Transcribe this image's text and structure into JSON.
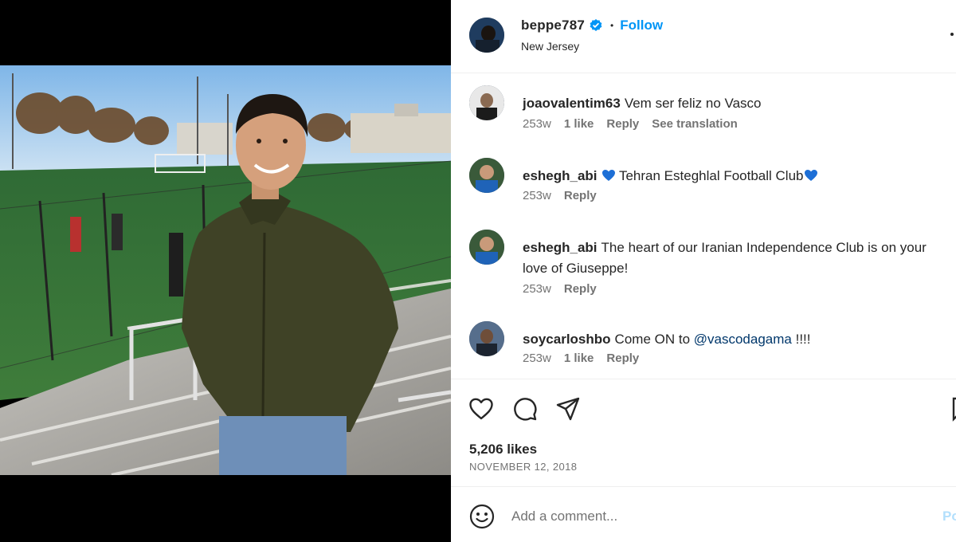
{
  "post": {
    "username": "beppe787",
    "follow_label": "Follow",
    "separator": "•",
    "location": "New Jersey"
  },
  "comments": [
    {
      "username": "joaovalentim63",
      "text": "Vem ser feliz no Vasco",
      "age": "253w",
      "likes": "1 like",
      "reply": "Reply",
      "translate": "See translation"
    },
    {
      "username": "eshegh_abi",
      "text_before": "",
      "text_main": "Tehran Esteghlal Football Club",
      "age": "253w",
      "reply": "Reply"
    },
    {
      "username": "eshegh_abi",
      "text": "The heart of our Iranian Independence Club is on your love of Giuseppe!",
      "age": "253w",
      "reply": "Reply"
    },
    {
      "username": "soycarloshbo",
      "text_before": "Come ON to",
      "mention": "@vascodagama",
      "text_after": "!!!!",
      "age": "253w",
      "likes": "1 like",
      "reply": "Reply"
    }
  ],
  "actions": {
    "like_icon": "heart-outline-icon",
    "comment_icon": "comment-bubble-icon",
    "share_icon": "paper-plane-icon",
    "save_icon": "bookmark-icon"
  },
  "likes_text": "5,206 likes",
  "date_text": "NOVEMBER 12, 2018",
  "add_comment": {
    "placeholder": "Add a comment...",
    "post_label": "Post",
    "emoji_icon": "smiley-icon"
  },
  "colors": {
    "follow_blue": "#0095f6",
    "verified_blue": "#0095f6",
    "heart_blue": "#1d6fd6",
    "muted_text": "#737373",
    "mention": "#00376b"
  }
}
